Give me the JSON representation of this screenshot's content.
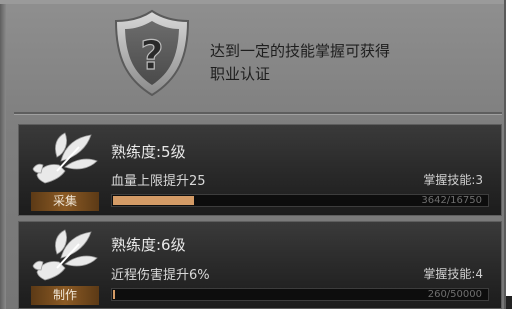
{
  "header": {
    "hint_line1": "达到一定的技能掌握可获得",
    "hint_line2": "职业认证",
    "shield_icon": "shield-question-icon"
  },
  "skills": [
    {
      "name": "采集",
      "icon": "leaf-hand-icon",
      "level_text": "熟练度:5级",
      "bonus_text": "血量上限提升25",
      "mastery_text": "掌握技能:3",
      "progress_current": 3642,
      "progress_max": 16750,
      "progress_text": "3642/16750"
    },
    {
      "name": "制作",
      "icon": "leaf-hand-icon",
      "level_text": "熟练度:6级",
      "bonus_text": "近程伤害提升6%",
      "mastery_text": "掌握技能:4",
      "progress_current": 260,
      "progress_max": 50000,
      "progress_text": "260/50000"
    }
  ],
  "colors": {
    "progress_fill": "#d49b66",
    "tag_bg": "#8b5a24"
  }
}
